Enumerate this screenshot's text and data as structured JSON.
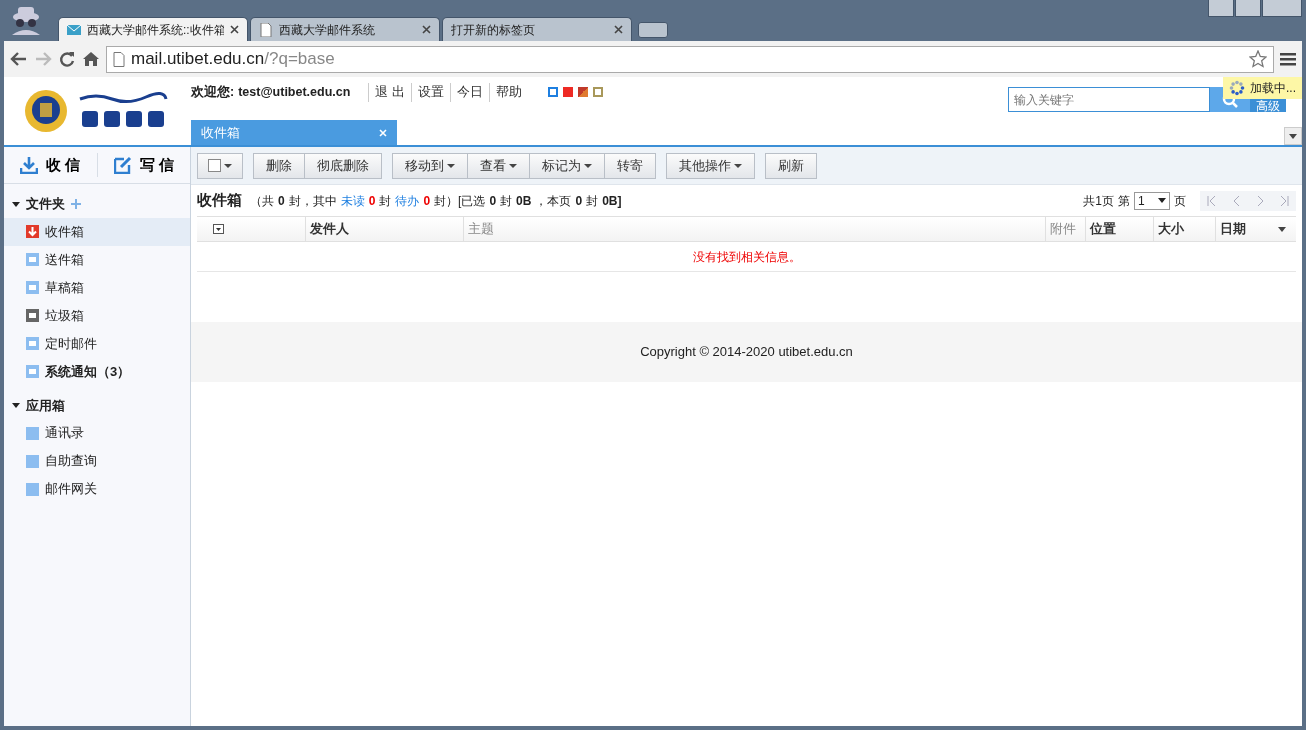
{
  "browser": {
    "tabs": [
      {
        "title": "西藏大学邮件系统::收件箱",
        "selected": true,
        "kind": "mail"
      },
      {
        "title": "西藏大学邮件系统",
        "selected": false,
        "kind": "page"
      },
      {
        "title": "打开新的标签页",
        "selected": false,
        "kind": "none"
      }
    ],
    "address": {
      "host": "mail.utibet.edu.cn",
      "path": "/?q=base"
    }
  },
  "header": {
    "welcome_label": "欢迎您:",
    "user": "test@utibet.edu.cn",
    "links": [
      "退 出",
      "设置",
      "今日",
      "帮助"
    ],
    "themes": [
      {
        "color": "#1e7fe0",
        "kind": "ring"
      },
      {
        "color": "#ee2a24",
        "kind": "solid"
      },
      {
        "color": "#c0392b",
        "kind": "diagonal"
      },
      {
        "color": "#a8985a",
        "kind": "ring"
      }
    ],
    "search": {
      "placeholder": "输入关键字"
    },
    "advanced": "高级",
    "loading": "加载中...",
    "open_tabs": [
      {
        "label": "收件箱",
        "selected": true,
        "closable": true
      }
    ]
  },
  "sidebar": {
    "actions": [
      {
        "label": "收 信",
        "kind": "receive"
      },
      {
        "label": "写 信",
        "kind": "compose"
      }
    ],
    "sections": [
      {
        "title": "文件夹",
        "expanded": true,
        "addable": true,
        "items": [
          {
            "label": "收件箱",
            "kind": "inbox",
            "selected": true,
            "bold": false
          },
          {
            "label": "送件箱",
            "kind": "folder",
            "selected": false,
            "bold": false
          },
          {
            "label": "草稿箱",
            "kind": "folder",
            "selected": false,
            "bold": false
          },
          {
            "label": "垃圾箱",
            "kind": "trash",
            "selected": false,
            "bold": false
          },
          {
            "label": "定时邮件",
            "kind": "folder",
            "selected": false,
            "bold": false
          },
          {
            "label": "系统通知（3）",
            "kind": "folder",
            "selected": false,
            "bold": true
          }
        ]
      },
      {
        "title": "应用箱",
        "expanded": true,
        "addable": false,
        "items": [
          {
            "label": "通讯录",
            "kind": "app",
            "selected": false,
            "bold": false
          },
          {
            "label": "自助查询",
            "kind": "app",
            "selected": false,
            "bold": false
          },
          {
            "label": "邮件网关",
            "kind": "app",
            "selected": false,
            "bold": false
          }
        ]
      }
    ]
  },
  "toolbar": [
    [
      {
        "kind": "checkbox",
        "menu": true
      }
    ],
    [
      {
        "label": "删除",
        "menu": false
      },
      {
        "label": "彻底删除",
        "menu": false
      }
    ],
    [
      {
        "label": "移动到",
        "menu": true
      },
      {
        "label": "查看",
        "menu": true
      },
      {
        "label": "标记为",
        "menu": true
      },
      {
        "label": "转寄",
        "menu": false
      }
    ],
    [
      {
        "label": "其他操作",
        "menu": true
      }
    ],
    [
      {
        "label": "刷新",
        "menu": false
      }
    ]
  ],
  "summary": {
    "title": "收件箱",
    "segments": [
      {
        "text": "（共",
        "kind": "plain"
      },
      {
        "text": "0",
        "kind": "count"
      },
      {
        "text": "封，其中",
        "kind": "plain"
      },
      {
        "text": "未读",
        "kind": "link"
      },
      {
        "text": "0",
        "kind": "alert"
      },
      {
        "text": "封",
        "kind": "plain"
      },
      {
        "text": "待办",
        "kind": "link"
      },
      {
        "text": "0",
        "kind": "alert"
      },
      {
        "text": "封）[已选",
        "kind": "plain"
      },
      {
        "text": "0",
        "kind": "count"
      },
      {
        "text": "封",
        "kind": "plain"
      },
      {
        "text": "0B",
        "kind": "count"
      },
      {
        "text": "，本页",
        "kind": "plain"
      },
      {
        "text": "0",
        "kind": "count"
      },
      {
        "text": "封",
        "kind": "plain"
      },
      {
        "text": "0B]",
        "kind": "count"
      }
    ]
  },
  "pager": {
    "total": "共1页",
    "prefix": "第",
    "page": "1",
    "suffix": "页",
    "nav": [
      {
        "kind": "first",
        "disabled": true
      },
      {
        "kind": "prev",
        "disabled": true
      },
      {
        "kind": "next",
        "disabled": true
      },
      {
        "kind": "last",
        "disabled": true
      }
    ]
  },
  "table": {
    "columns": [
      {
        "label": "发件人",
        "bold": true
      },
      {
        "label": "主题",
        "bold": false
      },
      {
        "label": "附件",
        "bold": false
      },
      {
        "label": "位置",
        "bold": true
      },
      {
        "label": "大小",
        "bold": true
      },
      {
        "label": "日期",
        "bold": true,
        "sorted": true
      }
    ],
    "empty": "没有找到相关信息。"
  },
  "footer": "Copyright © 2014-2020 utibet.edu.cn"
}
